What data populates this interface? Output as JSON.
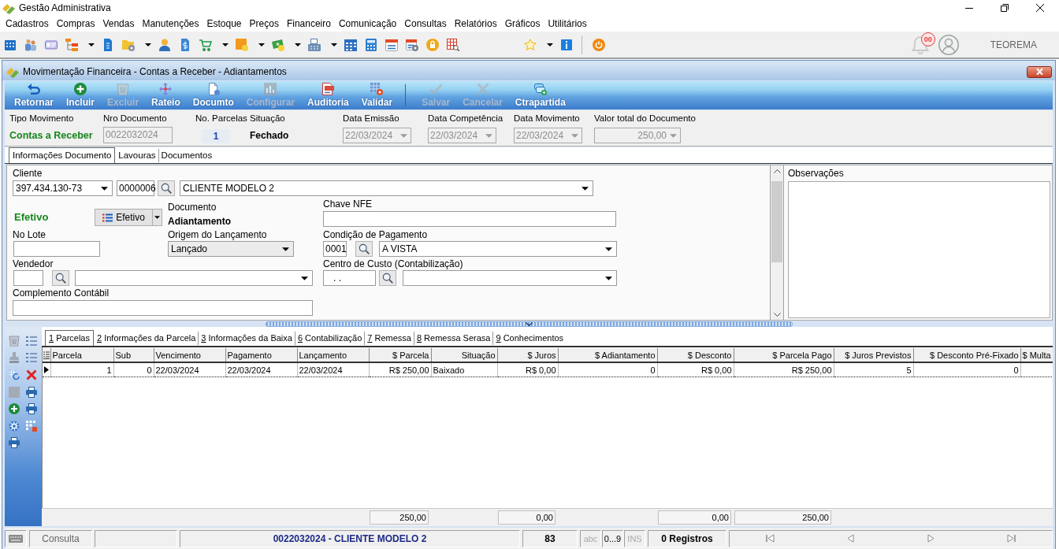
{
  "app": {
    "title": "Gestão Administrativa"
  },
  "menu": [
    "Cadastros",
    "Compras",
    "Vendas",
    "Manutenções",
    "Estoque",
    "Preços",
    "Financeiro",
    "Comunicação",
    "Consultas",
    "Relatórios",
    "Gráficos",
    "Utilitários"
  ],
  "toolbar": {
    "notifications": "00",
    "user": "TEOREMA"
  },
  "window": {
    "title": "Movimentação Financeira - Contas a Receber - Adiantamentos"
  },
  "actions": {
    "groups": [
      [
        {
          "label": "Retornar",
          "disabled": false
        },
        {
          "label": "Incluir",
          "disabled": false
        },
        {
          "label": "Excluir",
          "disabled": true
        },
        {
          "label": "Rateio",
          "disabled": false
        },
        {
          "label": "Documto",
          "disabled": false
        },
        {
          "label": "Configurar",
          "disabled": true
        },
        {
          "label": "Auditoria",
          "disabled": false
        },
        {
          "label": "Validar",
          "disabled": false
        }
      ],
      [
        {
          "label": "Salvar",
          "disabled": true
        },
        {
          "label": "Cancelar",
          "disabled": true
        },
        {
          "label": "Ctrapartida",
          "disabled": false
        }
      ]
    ]
  },
  "header": {
    "fields": [
      {
        "label": "Tipo Movimento",
        "value": "Contas a Receber",
        "kind": "status",
        "disabled": false
      },
      {
        "label": "Nro Documento",
        "value": "0022032024",
        "kind": "input",
        "disabled": true
      },
      {
        "label": "No. Parcelas",
        "value": "1",
        "kind": "count",
        "disabled": false
      },
      {
        "label": "Situação",
        "value": "Fechado",
        "kind": "text",
        "disabled": false
      },
      {
        "label": "Data Emissão",
        "value": "22/03/2024",
        "kind": "date",
        "disabled": true
      },
      {
        "label": "Data Competência",
        "value": "22/03/2024",
        "kind": "date",
        "disabled": true
      },
      {
        "label": "Data Movimento",
        "value": "22/03/2024",
        "kind": "date",
        "disabled": true
      },
      {
        "label": "Valor total do Documento",
        "value": "250,00",
        "kind": "amount",
        "disabled": true
      }
    ]
  },
  "document_tabs": [
    {
      "label": "Informações Documento",
      "selected": true
    },
    {
      "label": "Lavouras",
      "selected": false
    },
    {
      "label": "Documentos",
      "selected": false
    }
  ],
  "form": {
    "client": {
      "label": "Cliente",
      "document": "397.434.130-73",
      "code": "0000006",
      "name": "CLIENTE MODELO 2"
    },
    "status": {
      "value": "Efetivo",
      "button": "Efetivo"
    },
    "document": {
      "label": "Documento",
      "value": "Adiantamento"
    },
    "nfe_key": {
      "label": "Chave NFE"
    },
    "batch": {
      "label": "No Lote"
    },
    "origin": {
      "label": "Origem do Lançamento",
      "value": "Lançado"
    },
    "payment_terms": {
      "label": "Condição de Pagamento",
      "code": "0001",
      "name": "A VISTA"
    },
    "seller": {
      "label": "Vendedor"
    },
    "cost_center": {
      "label": "Centro de Custo (Contabilização)",
      "code": ". ."
    },
    "accounting_note": {
      "label": "Complemento Contábil"
    }
  },
  "notes": {
    "label": "Observações"
  },
  "bottom_tabs": [
    {
      "key": "1",
      "label": "Parcelas",
      "selected": true
    },
    {
      "key": "2",
      "label": "Informações da Parcela",
      "selected": false
    },
    {
      "key": "3",
      "label": "Informações da Baixa",
      "selected": false
    },
    {
      "key": "6",
      "label": "Contabilização",
      "selected": false
    },
    {
      "key": "7",
      "label": "Remessa",
      "selected": false
    },
    {
      "key": "8",
      "label": "Remessa Serasa",
      "selected": false
    },
    {
      "key": "9",
      "label": "Conhecimentos",
      "selected": false
    }
  ],
  "table": {
    "columns": [
      "Parcela",
      "Sub",
      "Vencimento",
      "Pagamento",
      "Lançamento",
      "$ Parcela",
      "Situação",
      "$ Juros",
      "$ Adiantamento",
      "$ Desconto",
      "$ Parcela Pago",
      "$ Juros Previstos",
      "$ Desconto Pré-Fixado",
      "$ Multa"
    ],
    "rows": [
      {
        "selected": true,
        "cells": [
          "1",
          "0",
          "22/03/2024",
          "22/03/2024",
          "22/03/2024",
          "R$ 250,00",
          "Baixado",
          "R$ 0,00",
          "0",
          "R$ 0,00",
          "R$ 250,00",
          "5",
          "0"
        ]
      }
    ],
    "totals": [
      "250,00",
      "0,00",
      "0,00",
      "250,00"
    ]
  },
  "status_bar": {
    "mode": "Consulta",
    "record": "0022032024 - CLIENTE MODELO 2",
    "count": "83",
    "indicators": [
      {
        "label": "abc",
        "on": false
      },
      {
        "label": "0...9",
        "on": true
      },
      {
        "label": "INS",
        "on": false
      }
    ],
    "records": "0 Registros"
  }
}
